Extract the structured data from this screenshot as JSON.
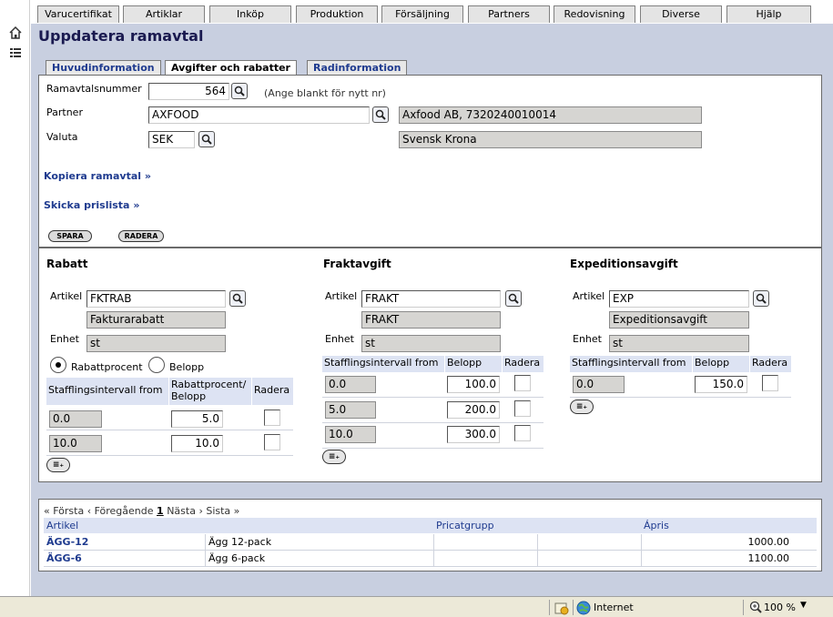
{
  "menu": [
    "Varucertifikat",
    "Artiklar",
    "Inköp",
    "Produktion",
    "Försäljning",
    "Partners",
    "Redovisning",
    "Diverse",
    "Hjälp"
  ],
  "sidebar": {
    "home_icon": "home-icon",
    "list_icon": "list-icon"
  },
  "page_title": "Uppdatera ramavtal",
  "tabs": [
    "Huvudinformation",
    "Avgifter och rabatter",
    "Radinformation"
  ],
  "header": {
    "ramavtal_label": "Ramavtalsnummer",
    "ramavtal_value": "564",
    "ramavtal_hint": "(Ange blankt för nytt nr)",
    "partner_label": "Partner",
    "partner_value": "AXFOOD",
    "partner_desc": "Axfood AB, 7320240010014",
    "valuta_label": "Valuta",
    "valuta_value": "SEK",
    "valuta_desc": "Svensk Krona",
    "copy_link": "Kopiera ramavtal »",
    "send_link": "Skicka prislista »",
    "save_button": "SPARA",
    "delete_button": "RADERA"
  },
  "rabatt": {
    "title": "Rabatt",
    "artikel_label": "Artikel",
    "artikel_value": "FKTRAB",
    "artikel_desc": "Fakturarabatt",
    "enhet_label": "Enhet",
    "enhet_value": "st",
    "radio_procent": "Rabattprocent",
    "radio_belopp": "Belopp",
    "col_interval": "Stafflingsintervall from",
    "col_value_1": "Rabattprocent/",
    "col_value_2": "Belopp",
    "col_delete": "Radera",
    "rows": [
      {
        "from": "0.0",
        "value": "5.0"
      },
      {
        "from": "10.0",
        "value": "10.0"
      }
    ]
  },
  "frakt": {
    "title": "Fraktavgift",
    "artikel_label": "Artikel",
    "artikel_value": "FRAKT",
    "artikel_desc": "FRAKT",
    "enhet_label": "Enhet",
    "enhet_value": "st",
    "col_interval": "Stafflingsintervall from",
    "col_value": "Belopp",
    "col_delete": "Radera",
    "rows": [
      {
        "from": "0.0",
        "value": "100.0"
      },
      {
        "from": "5.0",
        "value": "200.0"
      },
      {
        "from": "10.0",
        "value": "300.0"
      }
    ]
  },
  "expedition": {
    "title": "Expeditionsavgift",
    "artikel_label": "Artikel",
    "artikel_value": "EXP",
    "artikel_desc": "Expeditionsavgift",
    "enhet_label": "Enhet",
    "enhet_value": "st",
    "col_interval": "Stafflingsintervall from",
    "col_value": "Belopp",
    "col_delete": "Radera",
    "rows": [
      {
        "from": "0.0",
        "value": "150.0"
      }
    ]
  },
  "add_row_label": "≡₊",
  "pager": {
    "first": "« Första",
    "prev": "‹ Föregående",
    "current": "1",
    "next": "Nästa ›",
    "last": "Sista »"
  },
  "article_grid": {
    "columns": [
      "Artikel",
      "Pricatgrupp",
      "Ápris"
    ],
    "rows": [
      {
        "artikel": "ÄGG-12",
        "benamning": "Ägg 12-pack",
        "pris": "1000.00"
      },
      {
        "artikel": "ÄGG-6",
        "benamning": "Ägg 6-pack",
        "pris": "1100.00"
      }
    ]
  },
  "statusbar": {
    "zone": "Internet",
    "zoom": "100 %"
  },
  "colors": {
    "link": "#1f3b8f",
    "content_bg": "#c8cfe0",
    "header_bg": "#dde3f3",
    "readonly": "#d6d5d2"
  }
}
